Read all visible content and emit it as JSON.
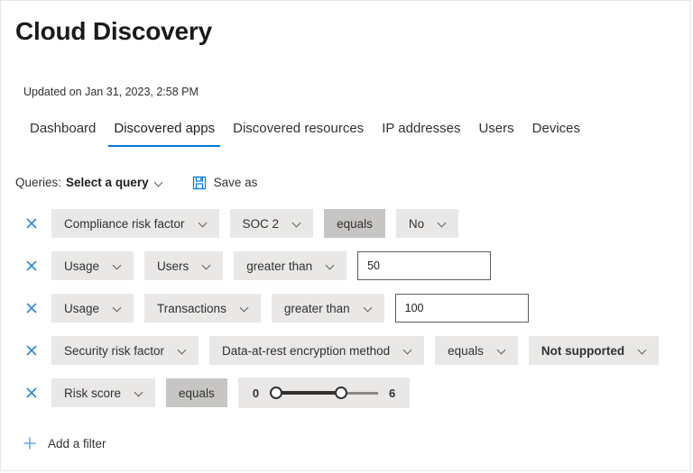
{
  "page": {
    "title": "Cloud Discovery",
    "updated": "Updated on Jan 31, 2023, 2:58 PM"
  },
  "tabs": [
    {
      "label": "Dashboard",
      "active": false
    },
    {
      "label": "Discovered apps",
      "active": true
    },
    {
      "label": "Discovered resources",
      "active": false
    },
    {
      "label": "IP addresses",
      "active": false
    },
    {
      "label": "Users",
      "active": false
    },
    {
      "label": "Devices",
      "active": false
    }
  ],
  "queries": {
    "label": "Queries:",
    "selected": "Select a query",
    "save_as_label": "Save as",
    "save_icon": "save-floppy-icon",
    "chevron_icon": "chevron-down-icon"
  },
  "filters": [
    {
      "remove_icon": "close-x-icon",
      "field": "Compliance risk factor",
      "subfield": "SOC 2",
      "operator": "equals",
      "value": "No"
    },
    {
      "remove_icon": "close-x-icon",
      "field": "Usage",
      "subfield": "Users",
      "operator": "greater than",
      "value": "50"
    },
    {
      "remove_icon": "close-x-icon",
      "field": "Usage",
      "subfield": "Transactions",
      "operator": "greater than",
      "value": "100"
    },
    {
      "remove_icon": "close-x-icon",
      "field": "Security risk factor",
      "subfield": "Data-at-rest encryption method",
      "operator": "equals",
      "value": "Not supported"
    },
    {
      "remove_icon": "close-x-icon",
      "field": "Risk score",
      "operator": "equals",
      "slider": {
        "min": "0",
        "max": "6",
        "low_value": 0,
        "high_value": 4
      }
    }
  ],
  "add_filter": {
    "label": "Add a filter",
    "icon": "plus-icon"
  },
  "colors": {
    "accent": "#0078d4",
    "link_icon": "#4a9ce0",
    "pill_bg": "#e9e8e7",
    "pill_static_bg": "#c8c6c4",
    "text": "#323130"
  }
}
